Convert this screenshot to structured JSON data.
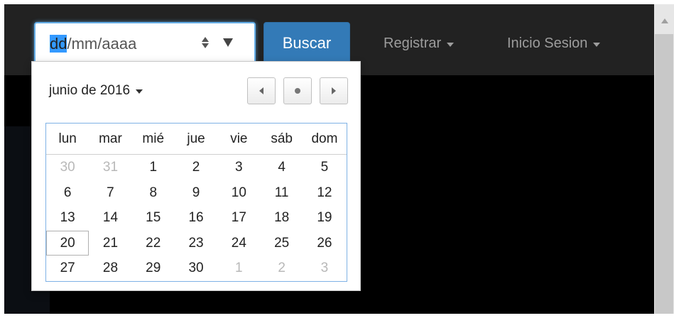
{
  "search": {
    "date_placeholder": {
      "day": "dd",
      "rest": "/mm/aaaa"
    },
    "button_label": "Buscar"
  },
  "nav": {
    "registrar_label": "Registrar",
    "login_label": "Inicio Sesion"
  },
  "datepicker": {
    "month_label": "junio de 2016",
    "weekdays": [
      "lun",
      "mar",
      "mié",
      "jue",
      "vie",
      "sáb",
      "dom"
    ],
    "weeks": [
      [
        "30",
        "31",
        "1",
        "2",
        "3",
        "4",
        "5"
      ],
      [
        "6",
        "7",
        "8",
        "9",
        "10",
        "11",
        "12"
      ],
      [
        "13",
        "14",
        "15",
        "16",
        "17",
        "18",
        "19"
      ],
      [
        "20",
        "21",
        "22",
        "23",
        "24",
        "25",
        "26"
      ],
      [
        "27",
        "28",
        "29",
        "30",
        "1",
        "2",
        "3"
      ]
    ],
    "outside_month": [
      [
        true,
        true,
        false,
        false,
        false,
        false,
        false
      ],
      [
        false,
        false,
        false,
        false,
        false,
        false,
        false
      ],
      [
        false,
        false,
        false,
        false,
        false,
        false,
        false
      ],
      [
        false,
        false,
        false,
        false,
        false,
        false,
        false
      ],
      [
        false,
        false,
        false,
        false,
        true,
        true,
        true
      ]
    ],
    "today": "20"
  },
  "colors": {
    "navbar": "#222222",
    "primary_button": "#337ab7",
    "input_focus": "#66afe9",
    "muted_day": "#b8b8b8"
  },
  "icons": {
    "spinner": "spin-updown-icon",
    "dropdown": "dropdown-arrow-icon",
    "prev": "chevron-left-icon",
    "today": "dot-icon",
    "next": "chevron-right-icon"
  }
}
